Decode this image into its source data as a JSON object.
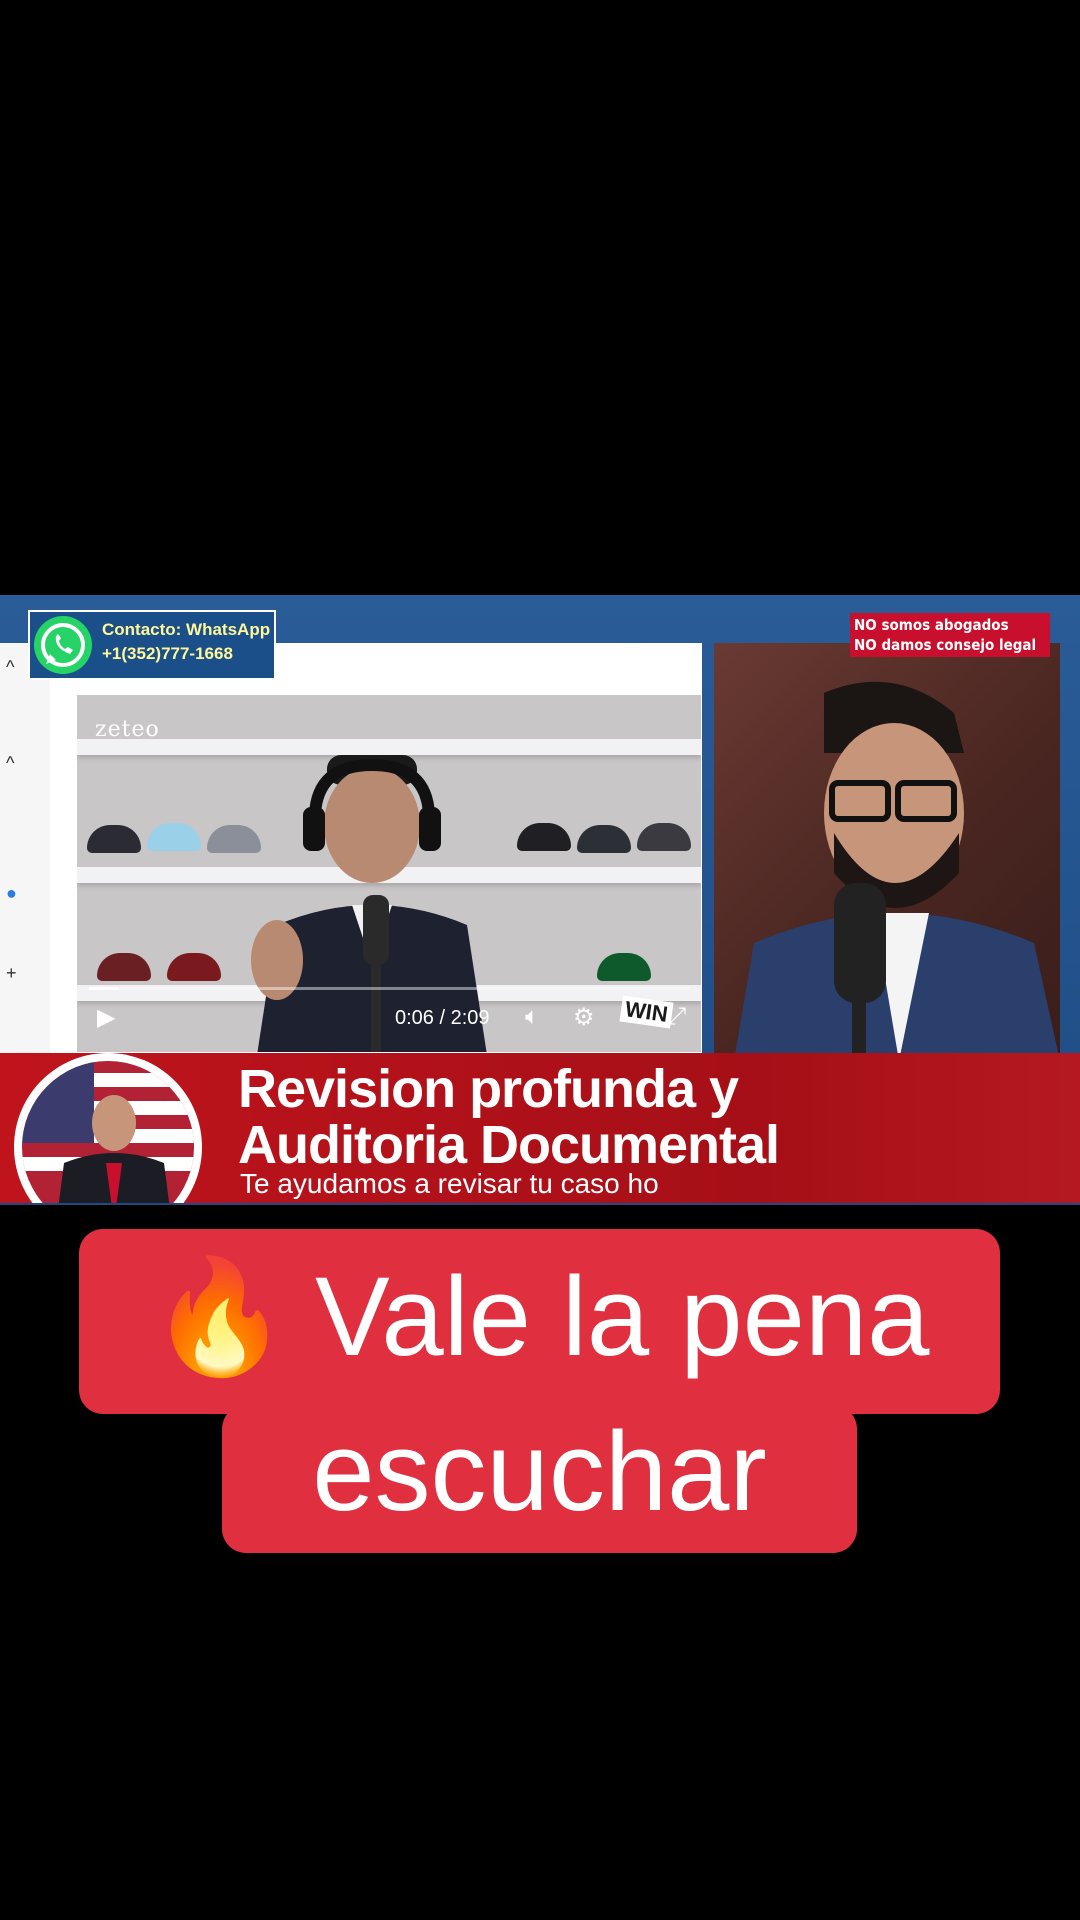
{
  "contact": {
    "label": "Contacto: WhatsApp",
    "phone": "+1(352)777-1668",
    "icon": "whatsapp-icon"
  },
  "disclaimer": {
    "line1": "NO somos abogados",
    "line2": "NO damos consejo legal"
  },
  "video_player": {
    "channel_logo": "zeteo",
    "current_time": "0:06",
    "duration": "2:09",
    "timecode": "0:06 / 2:09",
    "progress": 0.05,
    "controls": [
      "play-icon",
      "volume-icon",
      "settings-icon",
      "pip-icon",
      "fullscreen-icon"
    ],
    "badge": "WIN"
  },
  "banner": {
    "title_line1": "Revision profunda y",
    "title_line2": "Auditoria Documental",
    "subtitle": "Te ayudamos a revisar tu caso ho"
  },
  "caption": {
    "emoji": "🔥",
    "line1": "Vale la pena",
    "line2": "escuchar"
  },
  "colors": {
    "background": "#000000",
    "frame_blue": "#1e4b83",
    "banner_red": "#b5141d",
    "caption_red": "#e03040",
    "whatsapp_green": "#25d366",
    "contact_text": "#fff799"
  }
}
